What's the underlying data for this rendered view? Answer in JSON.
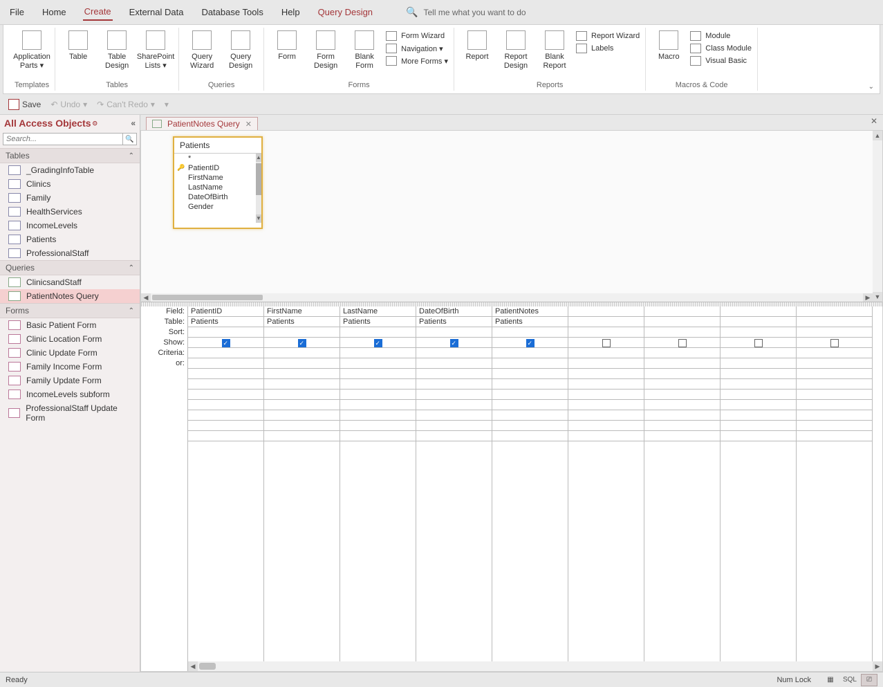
{
  "tabs": [
    "File",
    "Home",
    "Create",
    "External Data",
    "Database Tools",
    "Help",
    "Query Design"
  ],
  "tellme": "Tell me what you want to do",
  "ribbon": {
    "templates": {
      "label": "Templates",
      "items": [
        "Application\nParts ▾"
      ]
    },
    "tables": {
      "label": "Tables",
      "items": [
        "Table",
        "Table\nDesign",
        "SharePoint\nLists ▾"
      ]
    },
    "queries": {
      "label": "Queries",
      "items": [
        "Query\nWizard",
        "Query\nDesign"
      ]
    },
    "forms": {
      "label": "Forms",
      "big": [
        "Form",
        "Form\nDesign",
        "Blank\nForm"
      ],
      "small": [
        "Form Wizard",
        "Navigation ▾",
        "More Forms ▾"
      ]
    },
    "reports": {
      "label": "Reports",
      "big": [
        "Report",
        "Report\nDesign",
        "Blank\nReport"
      ],
      "small": [
        "Report Wizard",
        "Labels"
      ]
    },
    "macros": {
      "label": "Macros & Code",
      "big": [
        "Macro"
      ],
      "small": [
        "Module",
        "Class Module",
        "Visual Basic"
      ]
    }
  },
  "qat": {
    "save": "Save",
    "undo": "Undo",
    "redo": "Can't Redo"
  },
  "nav": {
    "title": "All Access Objects",
    "search_placeholder": "Search...",
    "sections": [
      {
        "name": "Tables",
        "items": [
          "_GradingInfoTable",
          "Clinics",
          "Family",
          "HealthServices",
          "IncomeLevels",
          "Patients",
          "ProfessionalStaff"
        ]
      },
      {
        "name": "Queries",
        "items": [
          "ClinicsandStaff",
          "PatientNotes Query"
        ],
        "selected": 1
      },
      {
        "name": "Forms",
        "items": [
          "Basic Patient Form",
          "Clinic Location Form",
          "Clinic Update Form",
          "Family Income Form",
          "Family Update Form",
          "IncomeLevels subform",
          "ProfessionalStaff Update Form"
        ]
      }
    ]
  },
  "doc_tab": {
    "title": "PatientNotes Query"
  },
  "table_box": {
    "title": "Patients",
    "fields": [
      "*",
      "PatientID",
      "FirstName",
      "LastName",
      "DateOfBirth",
      "Gender"
    ],
    "key_index": 1
  },
  "grid": {
    "row_labels": [
      "Field:",
      "Table:",
      "Sort:",
      "Show:",
      "Criteria:",
      "or:"
    ],
    "cols": [
      {
        "field": "PatientID",
        "table": "Patients",
        "show": true
      },
      {
        "field": "FirstName",
        "table": "Patients",
        "show": true
      },
      {
        "field": "LastName",
        "table": "Patients",
        "show": true
      },
      {
        "field": "DateOfBirth",
        "table": "Patients",
        "show": true
      },
      {
        "field": "PatientNotes",
        "table": "Patients",
        "show": true
      },
      {
        "field": "",
        "table": "",
        "show": false
      },
      {
        "field": "",
        "table": "",
        "show": false
      },
      {
        "field": "",
        "table": "",
        "show": false
      },
      {
        "field": "",
        "table": "",
        "show": false
      }
    ]
  },
  "status": {
    "ready": "Ready",
    "numlock": "Num Lock",
    "sql": "SQL"
  }
}
